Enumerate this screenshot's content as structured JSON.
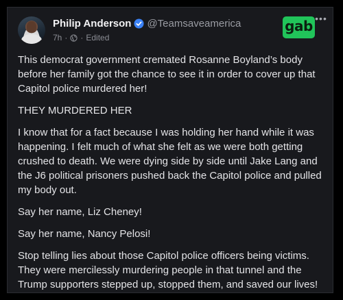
{
  "post": {
    "author": {
      "display_name": "Philip Anderson",
      "handle": "@Teamsaveamerica",
      "verified": true
    },
    "timestamp": "7h",
    "edited_label": "Edited",
    "visibility_icon": "globe-icon",
    "brand": {
      "logo_text": "gab",
      "logo_color": "#21c45a"
    },
    "more_icon": "more-horizontal-icon",
    "paragraphs": [
      "This democrat government cremated Rosanne Boyland’s body before her family got the chance to see it in order to cover up that Capitol police murdered her!",
      "THEY MURDERED HER",
      "I know that for a fact because I was holding her hand while it was happening. I felt much of what she felt as we were both getting crushed to death. We were dying side by side until Jake Lang and the J6 political prisoners pushed back the Capitol police and pulled my body out.",
      "Say her name, Liz Cheney!",
      "Say her name, Nancy Pelosi!",
      "Stop telling lies about those Capitol police officers being victims. They were mercilessly murdering people in that tunnel and the Trump supporters stepped up, stopped them, and saved our lives!"
    ]
  },
  "colors": {
    "card_background": "#18191d",
    "text": "#e4e4e7",
    "muted_text": "#9a9ca3",
    "verified_badge": "#3b82f6"
  }
}
